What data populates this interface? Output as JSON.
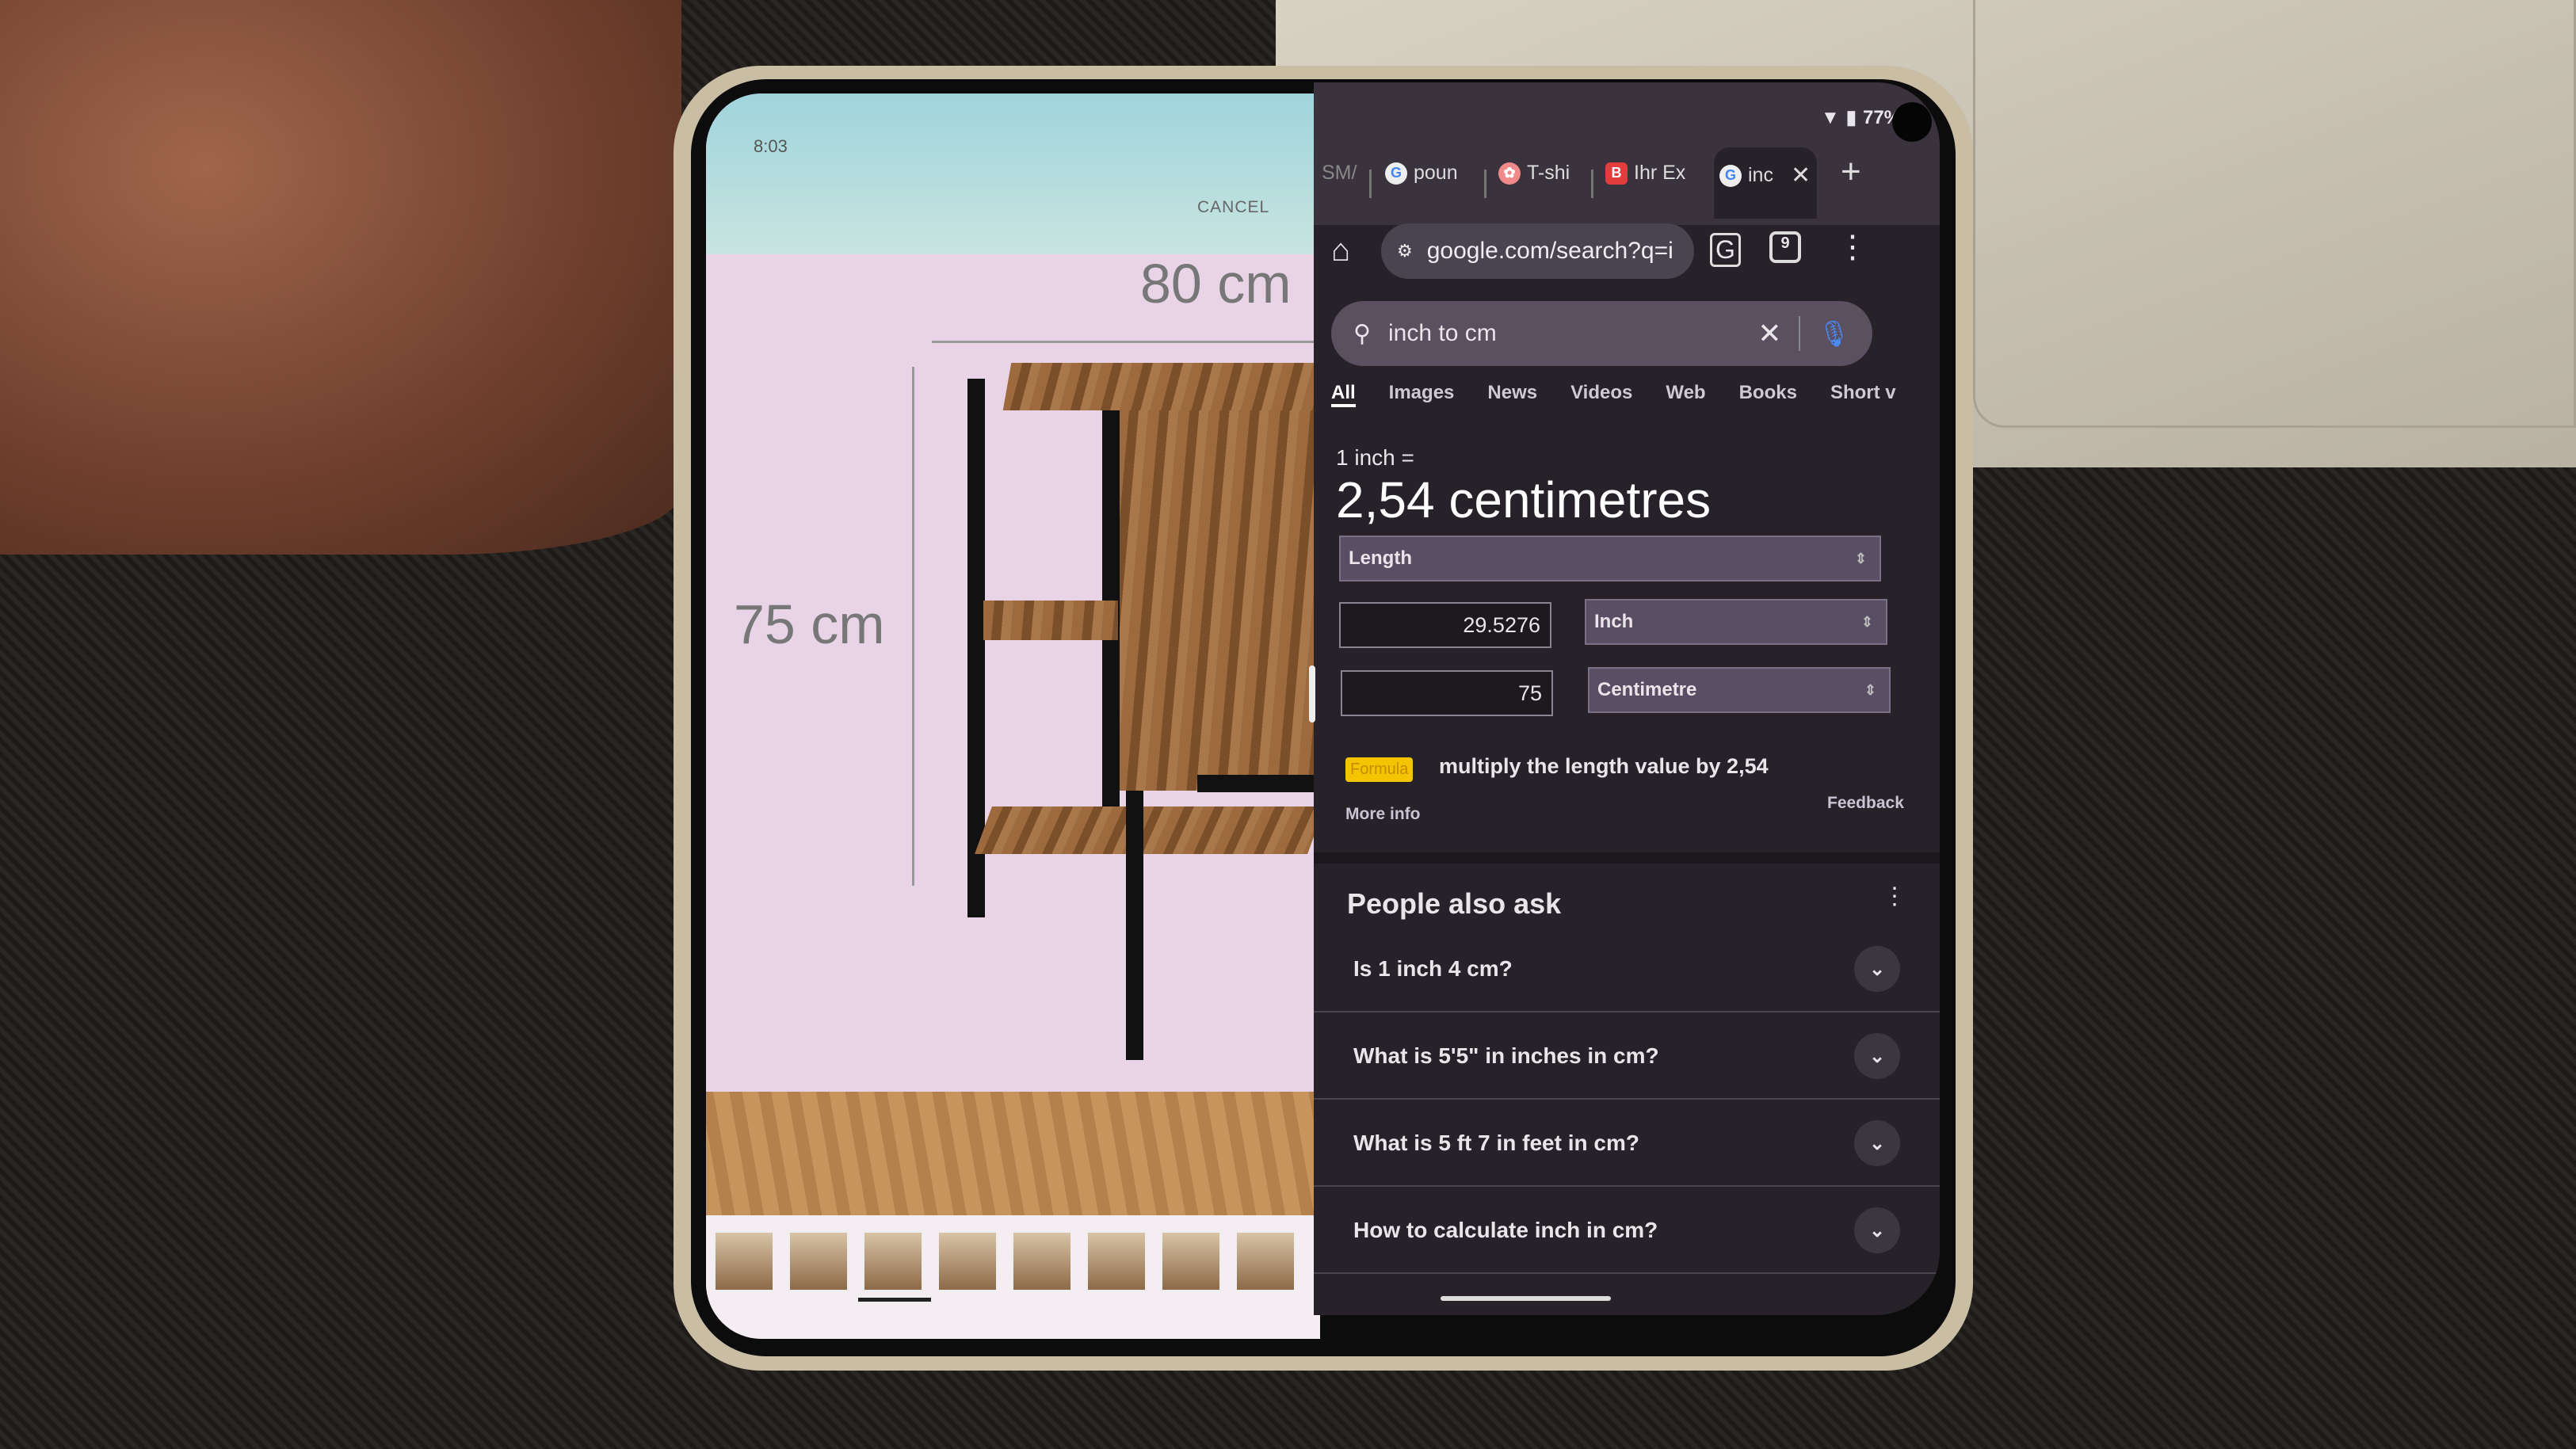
{
  "left_app": {
    "time": "8:03",
    "cancel_label": "CANCEL",
    "width_label": "80 cm",
    "height_label": "75 cm",
    "thumbnail_count": 8
  },
  "status": {
    "battery": "77%",
    "icons": [
      "wifi-icon",
      "battery-icon"
    ]
  },
  "browser": {
    "tabs": [
      {
        "title": "SM/"
      },
      {
        "title": "poun"
      },
      {
        "title": "T-shi"
      },
      {
        "title": "Ihr Ex"
      },
      {
        "title": "inc",
        "active": true
      }
    ],
    "new_tab": "+",
    "url": "google.com/search?q=i"
  },
  "search": {
    "query": "inch to cm",
    "tabs": [
      "All",
      "Images",
      "News",
      "Videos",
      "Web",
      "Books",
      "Short v"
    ],
    "active_tab": "All"
  },
  "converter": {
    "prefix": "1 inch =",
    "result": "2,54 centimetres",
    "category": "Length",
    "from_value": "29.5276",
    "from_unit": "Inch",
    "to_value": "75",
    "to_unit": "Centimetre",
    "formula_badge": "Formula",
    "formula_text": "multiply the length value by 2,54",
    "more_info": "More info",
    "feedback": "Feedback",
    "badge_color": "#f5c400"
  },
  "paa": {
    "title": "People also ask",
    "questions": [
      "Is 1 inch 4 cm?",
      "What is 5'5\" in inches in cm?",
      "What is 5 ft 7 in feet in cm?",
      "How to calculate inch in cm?"
    ]
  }
}
